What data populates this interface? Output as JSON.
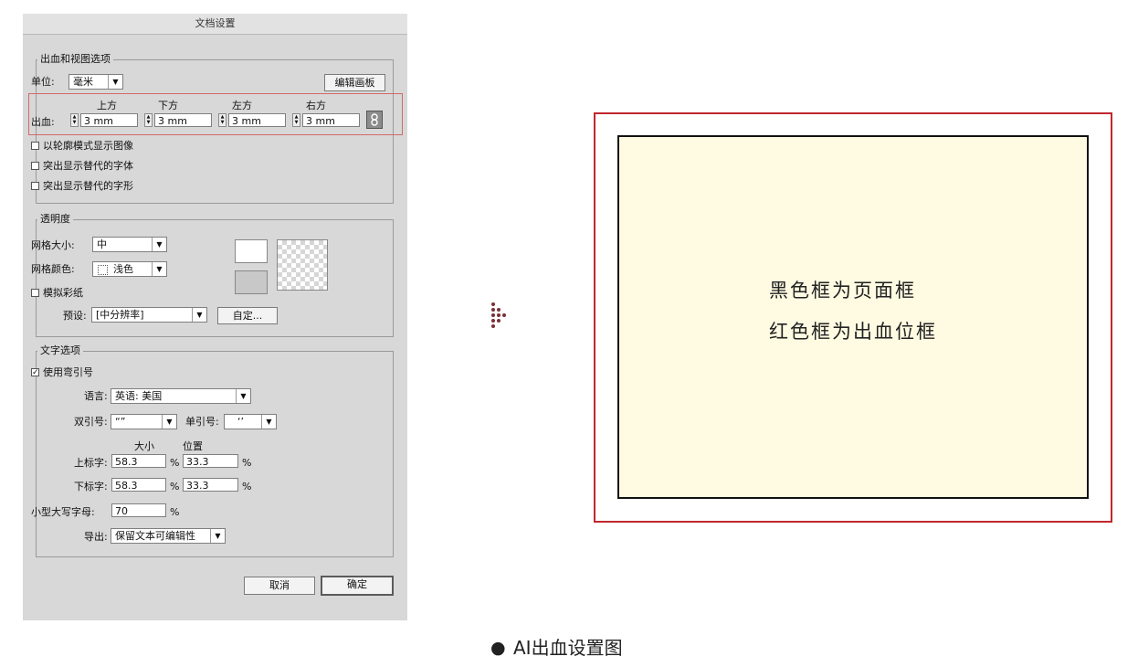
{
  "dialog": {
    "title": "文档设置",
    "bleed_view": {
      "legend": "出血和视图选项",
      "unit_label": "单位:",
      "unit_value": "毫米",
      "edit_artboards": "编辑画板",
      "bleed_label": "出血:",
      "top_label": "上方",
      "bottom_label": "下方",
      "left_label": "左方",
      "right_label": "右方",
      "top_value": "3 mm",
      "bottom_value": "3 mm",
      "left_value": "3 mm",
      "right_value": "3 mm",
      "outline_mode": "以轮廓模式显示图像",
      "highlight_fonts": "突出显示替代的字体",
      "highlight_glyphs": "突出显示替代的字形"
    },
    "transparency": {
      "legend": "透明度",
      "grid_size_label": "网格大小:",
      "grid_size_value": "中",
      "grid_color_label": "网格颜色:",
      "grid_color_value": "浅色",
      "simulate_paper": "模拟彩纸",
      "preset_label": "预设:",
      "preset_value": "[中分辨率]",
      "custom_button": "自定..."
    },
    "type_options": {
      "legend": "文字选项",
      "use_typographers_quotes": "使用弯引号",
      "use_typographers_quotes_checked": true,
      "language_label": "语言:",
      "language_value": "英语: 美国",
      "double_quotes_label": "双引号:",
      "double_quotes_value": "“”",
      "single_quotes_label": "单引号:",
      "single_quotes_value": "‘’",
      "size_header": "大小",
      "position_header": "位置",
      "superscript_label": "上标字:",
      "superscript_size": "58.3",
      "superscript_position": "33.3",
      "subscript_label": "下标字:",
      "subscript_size": "58.3",
      "subscript_position": "33.3",
      "small_caps_label": "小型大写字母:",
      "small_caps_value": "70",
      "percent": "%",
      "export_label": "导出:",
      "export_value": "保留文本可编辑性"
    },
    "cancel_button": "取消",
    "ok_button": "确定"
  },
  "illustration": {
    "line1": "黑色框为页面框",
    "line2": "红色框为出血位框",
    "page_fill_color": "#fffbe2",
    "bleed_frame_color": "#c1272d",
    "page_frame_color": "#111111"
  },
  "caption": {
    "bullet": "●",
    "text": "AI出血设置图"
  }
}
